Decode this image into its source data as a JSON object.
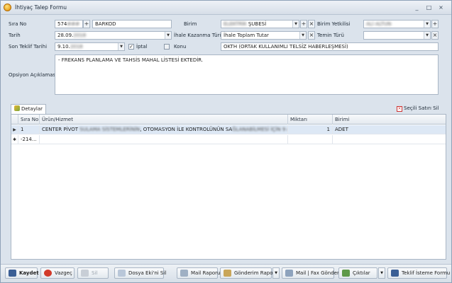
{
  "window": {
    "title": "İhtiyaç Talep Formu",
    "controls": [
      "_",
      "□",
      "×"
    ]
  },
  "form": {
    "sira_no": {
      "label": "Sıra No",
      "value": "574",
      "blurred_suffix": "###"
    },
    "barkod": {
      "value": "BARKOD"
    },
    "birim": {
      "label": "Birim",
      "blurred": "ELEKTRİK",
      "value": "ŞUBESİ"
    },
    "birim_yetkilisi": {
      "label": "Birim Yetkilisi",
      "blurred": "ALİ ALTUN"
    },
    "tarih": {
      "label": "Tarih",
      "value": "28.09.",
      "blurred": "2018"
    },
    "ihale_kazanma_turu": {
      "label": "İhale Kazanma Türü",
      "value": "İhale Toplam Tutar"
    },
    "temin_turu": {
      "label": "Temin Türü",
      "value": ""
    },
    "son_teklif_tarihi": {
      "label": "Son Teklif Tarihi",
      "value": "9.10.",
      "blurred": "2018"
    },
    "iptal": {
      "label": "İptal",
      "checked": true
    },
    "konu_checkbox": {
      "checked": false
    },
    "konu": {
      "label": "Konu",
      "value": "OKTH (ORTAK KULLANIMLI TELSİZ HABERLEŞMESİ)"
    },
    "opsiyon": {
      "label": "Opsiyon Açıklaması",
      "value": "- FREKANS PLANLAMA VE TAHSİS MAHAL LİSTESİ EKTEDİR."
    }
  },
  "tab": {
    "label": "Detaylar"
  },
  "selected_delete": {
    "label": "Seçili Satırı Sil"
  },
  "grid": {
    "columns": [
      "Sıra No",
      "Ürün/Hizmet",
      "Miktarı",
      "Birimi"
    ],
    "rows": [
      {
        "indicator": "▶",
        "sira": "1",
        "urun": "CENTER PİVOT ",
        "urun_blur": "SULAMA SİSTEMLERİNİN",
        "urun2": ", OTOMASYON İLE KONTROLÜNÜN SA",
        "urun_blur2": "ĞLANABİLMESİ İÇİN 9 ADE...",
        "miktar": "1",
        "birim": "ADET"
      },
      {
        "indicator": "✱",
        "sira": "-214...",
        "urun": "",
        "urun_blur": "",
        "urun2": "",
        "urun_blur2": "",
        "miktar": "",
        "birim": ""
      }
    ]
  },
  "footer": {
    "kaydet": "Kaydet",
    "vazgec": "Vazgeç",
    "sil": "Sil",
    "dosya_ekini_sil": "Dosya Eki'ni Sil",
    "mail_raporu": "Mail Raporu",
    "gonderim_raporu": "Gönderim Raporu",
    "mail_fax_gonder": "Mail | Fax Gönder",
    "ciktilar": "Çıktılar",
    "teklif_isteme_formu": "Teklif İsteme Formu"
  }
}
